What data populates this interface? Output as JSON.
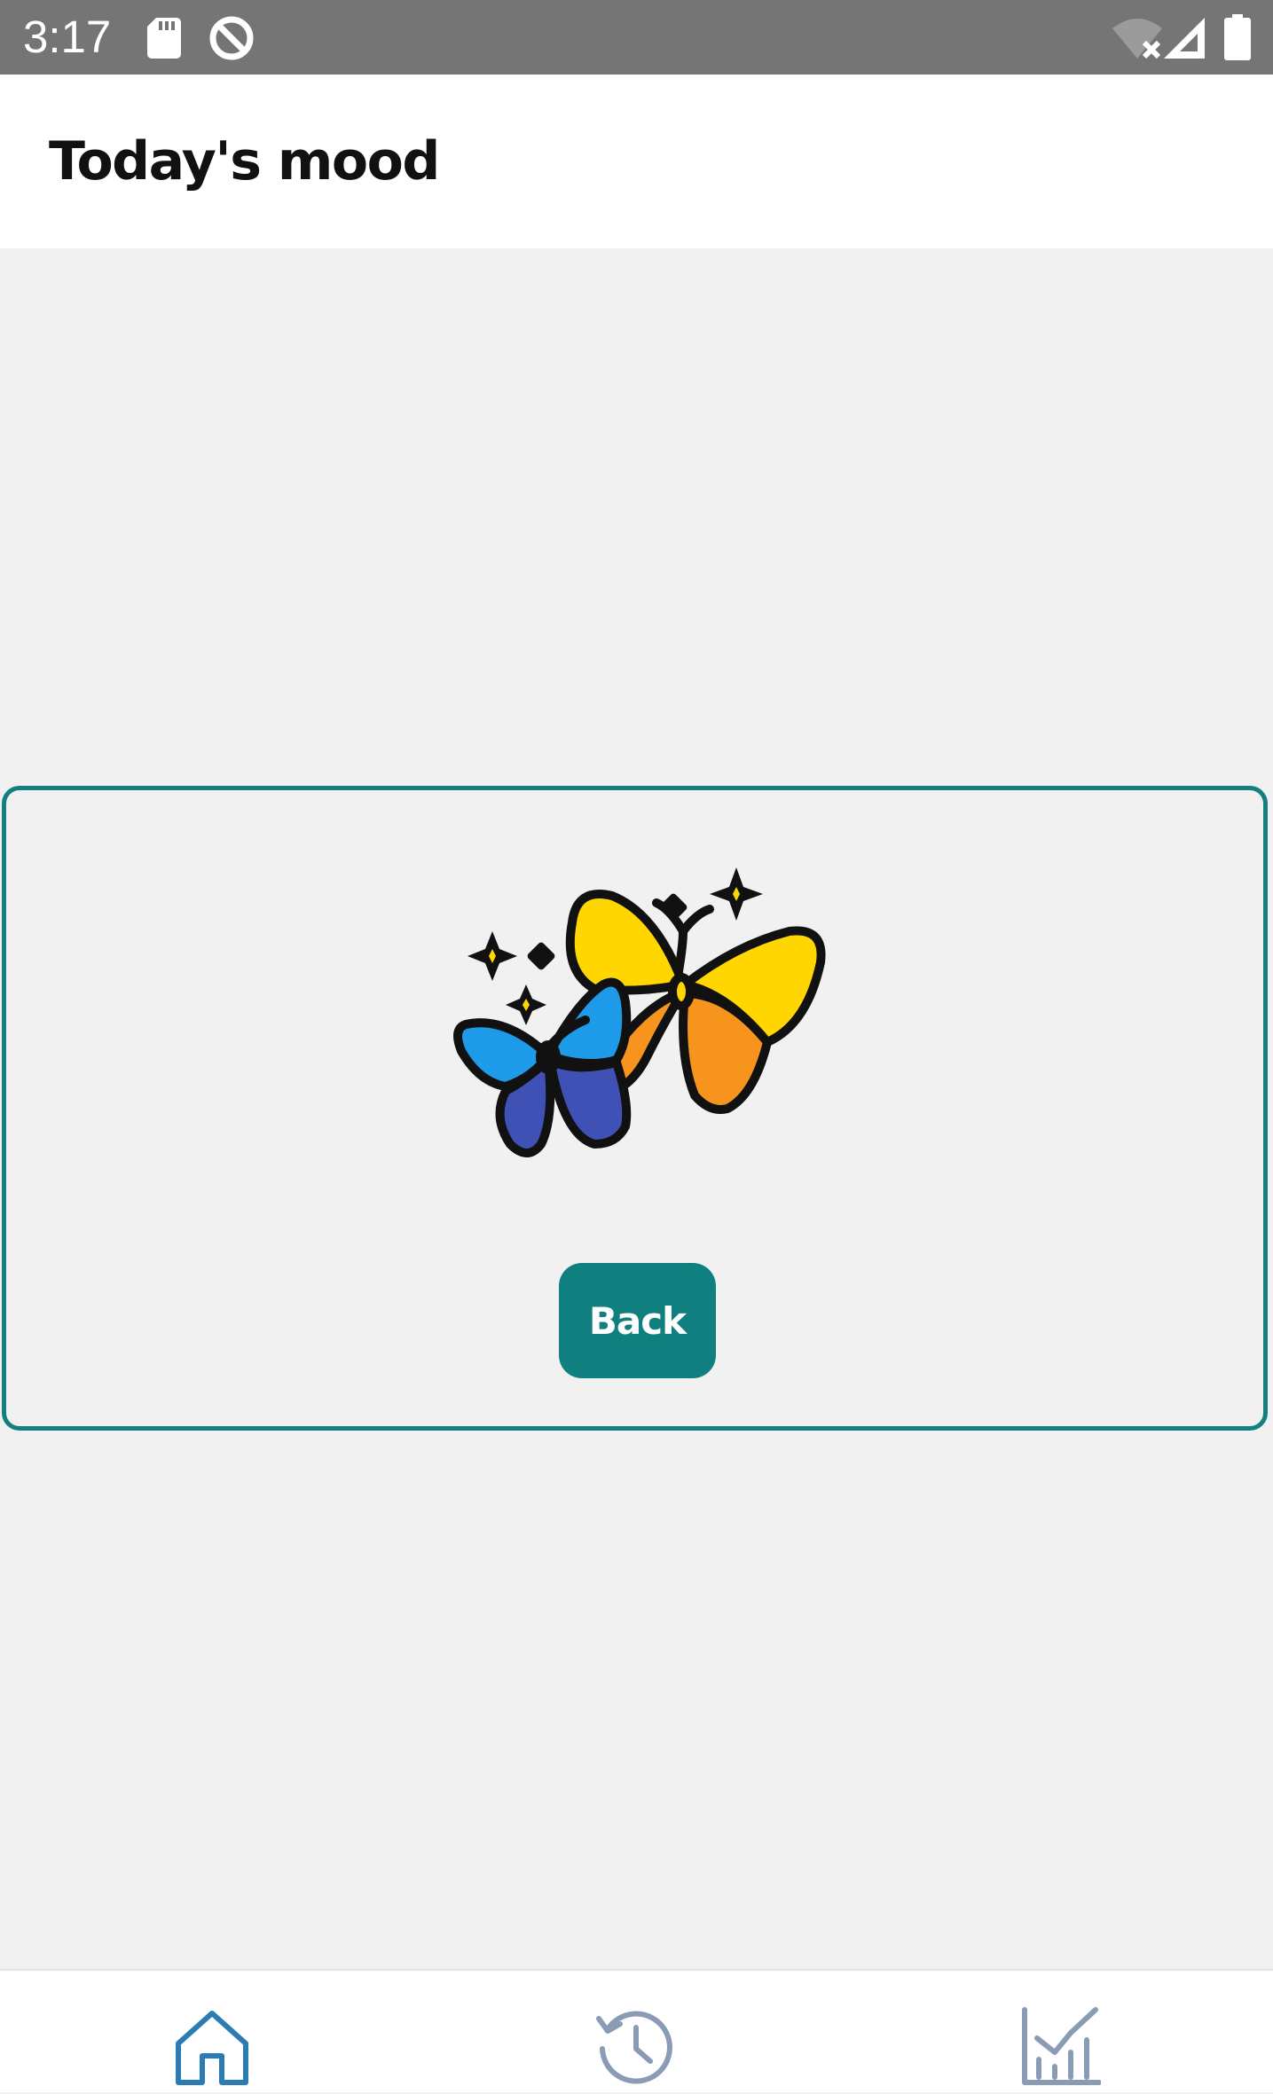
{
  "status_bar": {
    "time": "3:17",
    "icons": [
      "sd-card-icon",
      "data-saver-icon",
      "wifi-off-icon",
      "signal-icon",
      "battery-icon"
    ]
  },
  "header": {
    "title": "Today's mood"
  },
  "mood_card": {
    "illustration": "butterflies-icon",
    "back_label": "Back"
  },
  "bottom_nav": {
    "items": [
      {
        "icon": "home-icon",
        "active": true
      },
      {
        "icon": "history-icon",
        "active": false
      },
      {
        "icon": "stats-chart-icon",
        "active": false
      }
    ]
  },
  "colors": {
    "accent": "#147f7f",
    "button": "#0f7f7f",
    "nav_active": "#2b7bb5",
    "nav_inactive": "#8a9bb5",
    "background": "#f1f1f1",
    "status_bar": "#757575"
  }
}
